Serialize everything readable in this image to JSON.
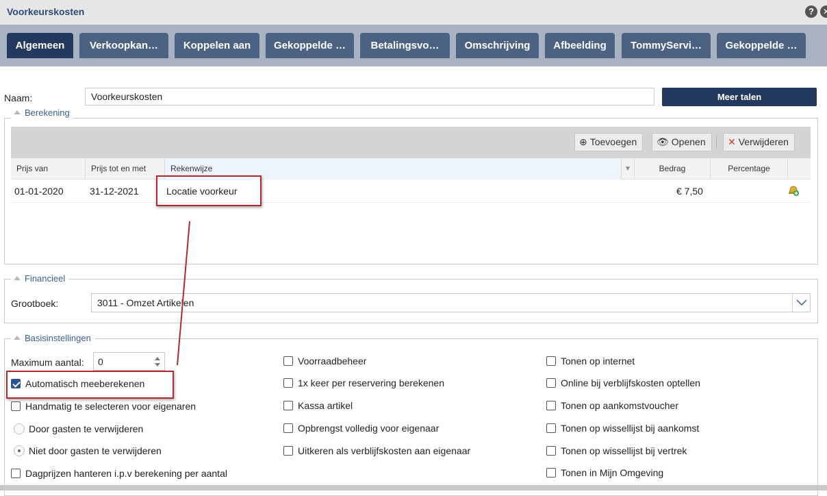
{
  "window": {
    "title": "Voorkeurskosten",
    "help_icon": "help-icon",
    "close_icon": "close-icon"
  },
  "tabs": [
    {
      "label": "Algemeen",
      "active": true
    },
    {
      "label": "Verkoopkan…"
    },
    {
      "label": "Koppelen aan"
    },
    {
      "label": "Gekoppelde …"
    },
    {
      "label": "Betalingsvo…"
    },
    {
      "label": "Omschrijving"
    },
    {
      "label": "Afbeelding"
    },
    {
      "label": "TommyServi…"
    },
    {
      "label": "Gekoppelde …"
    }
  ],
  "name": {
    "label": "Naam:",
    "value": "Voorkeurskosten",
    "more_languages": "Meer talen"
  },
  "berekening": {
    "legend": "Berekening",
    "toolbar": {
      "add": "Toevoegen",
      "open": "Openen",
      "delete": "Verwijderen"
    },
    "columns": [
      "Prijs van",
      "Prijs tot en met",
      "Rekenwijze",
      "Bedrag",
      "Percentage"
    ],
    "rows": [
      {
        "from": "01-01-2020",
        "to": "31-12-2021",
        "method": "Locatie voorkeur",
        "amount": "€ 7,50",
        "percentage": ""
      }
    ]
  },
  "financieel": {
    "legend": "Financieel",
    "ledger_label": "Grootboek:",
    "ledger_value": "3011 - Omzet Artikelen"
  },
  "basis": {
    "legend": "Basisinstellingen",
    "max_label": "Maximum aantal:",
    "max_value": "0",
    "col1": [
      {
        "label": "Automatisch meeberekenen",
        "type": "checkbox",
        "checked": true
      },
      {
        "label": "Handmatig te selecteren voor eigenaren",
        "type": "checkbox",
        "checked": false
      },
      {
        "label": "Door gasten te verwijderen",
        "type": "radio",
        "checked": false
      },
      {
        "label": "Niet door gasten te verwijderen",
        "type": "radio",
        "checked": true
      },
      {
        "label": "Dagprijzen hanteren i.p.v berekening per aantal",
        "type": "checkbox",
        "checked": false
      }
    ],
    "col2": [
      {
        "label": "Voorraadbeheer",
        "checked": false
      },
      {
        "label": "1x keer per reservering berekenen",
        "checked": false
      },
      {
        "label": "Kassa artikel",
        "checked": false
      },
      {
        "label": "Opbrengst volledig voor eigenaar",
        "checked": false
      },
      {
        "label": "Uitkeren als verblijfskosten aan eigenaar",
        "checked": false
      }
    ],
    "col3": [
      {
        "label": "Tonen op internet",
        "checked": false
      },
      {
        "label": "Online bij verblijfskosten optellen",
        "checked": false
      },
      {
        "label": "Tonen op aankomstvoucher",
        "checked": false
      },
      {
        "label": "Tonen op wissellijst bij aankomst",
        "checked": false
      },
      {
        "label": "Tonen op wissellijst bij vertrek",
        "checked": false
      },
      {
        "label": "Tonen in Mijn Omgeving",
        "checked": false
      }
    ]
  },
  "colors": {
    "accent": "#23395d",
    "tab": "#4b6283",
    "highlight": "#b3272e"
  }
}
